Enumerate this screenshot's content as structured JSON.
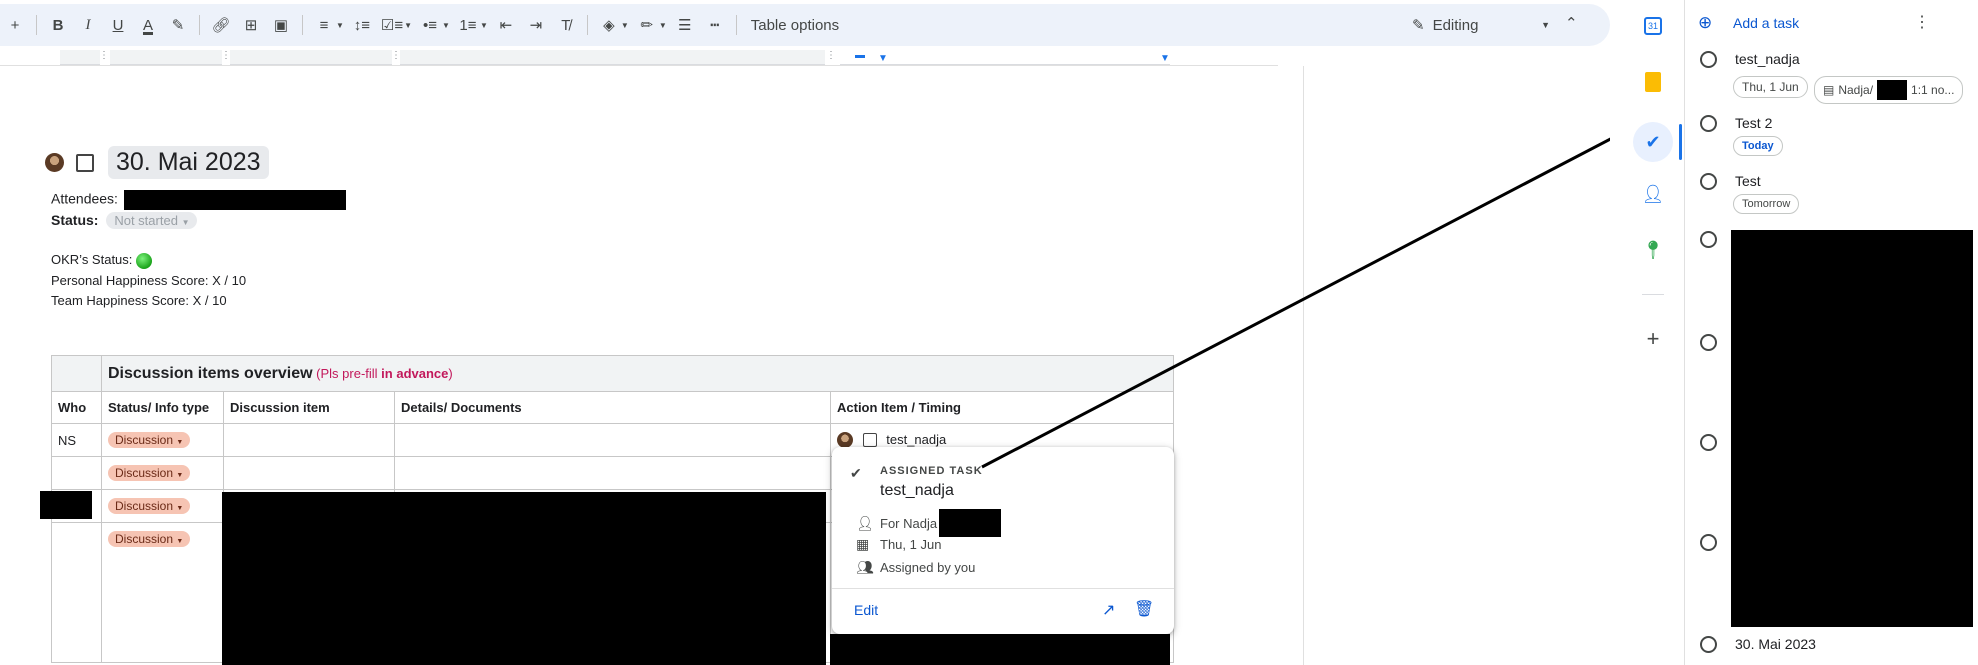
{
  "toolbar": {
    "items": [
      "plus",
      "bold",
      "italic",
      "underline",
      "text-color",
      "highlight",
      "link",
      "add-comment",
      "image",
      "align",
      "line-spacing",
      "checklist",
      "bulleted-list",
      "numbered-list",
      "decrease-indent",
      "increase-indent",
      "clear-formatting",
      "fill-color",
      "border-color",
      "border-width",
      "border-dash"
    ],
    "table_options": "Table options",
    "mode": "Editing"
  },
  "doc": {
    "date_chip": "30. Mai 2023",
    "attendees_label": "Attendees:",
    "status_label": "Status:",
    "status_value": "Not started",
    "okr_label": "OKR’s Status:",
    "personal_happiness": "Personal Happiness Score:  X  / 10",
    "team_happiness": "Team Happiness Score: X / 10",
    "table": {
      "title": "Discussion items overview",
      "title_note_a": "(Pls pre-fill ",
      "title_note_b": "in advance",
      "title_note_c": ")",
      "headers": [
        "Who",
        "Status/ Info type",
        "Discussion item",
        "Details/ Documents",
        "Action Item / Timing"
      ],
      "rows": [
        {
          "who": "NS",
          "status": "Discussion",
          "task": "test_nadja"
        },
        {
          "who": "",
          "status": "Discussion",
          "task": ""
        },
        {
          "who": "",
          "status": "Discussion",
          "task": ""
        },
        {
          "who": "",
          "status": "Discussion",
          "task": ""
        }
      ]
    }
  },
  "popup": {
    "kicker": "ASSIGNED TASK",
    "title": "test_nadja",
    "for": "For Nadja",
    "date": "Thu, 1 Jun",
    "assigned": "Assigned by you",
    "edit": "Edit"
  },
  "tasks_panel": {
    "add_task": "Add a task",
    "tasks": [
      {
        "name": "test_nadja",
        "date": "Thu, 1 Jun",
        "doc": "Nadja/",
        "doc_suffix": "1:1 no..."
      },
      {
        "name": "Test 2",
        "date": "Today"
      },
      {
        "name": "Test",
        "date": "Tomorrow"
      },
      {
        "name": "30. Mai 2023"
      }
    ]
  },
  "colors": {
    "accent": "#0b57d0",
    "toolbar_bg": "#edf2fa",
    "discussion_chip": "#f6c4b3",
    "note_pink": "#c2185b"
  }
}
